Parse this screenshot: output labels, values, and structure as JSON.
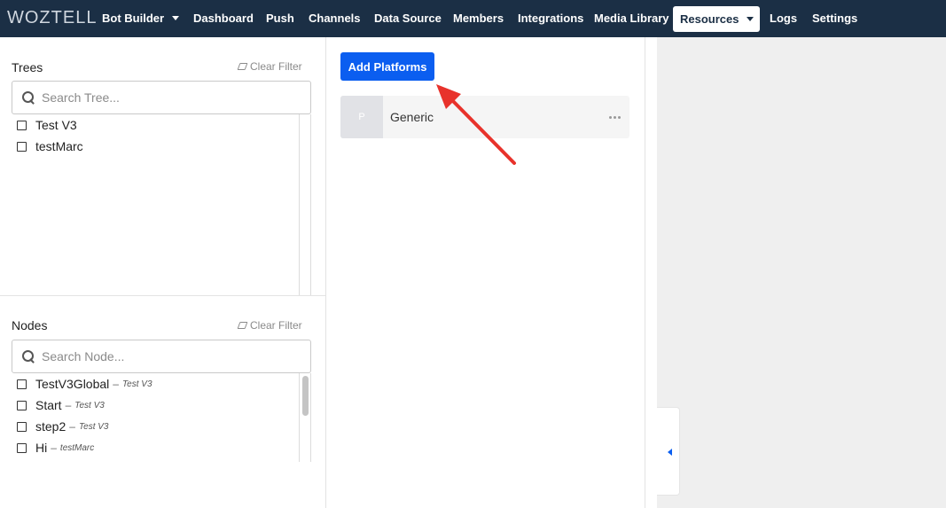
{
  "brand": {
    "logo": "WOZTELL",
    "accent": "#3bb3c9",
    "nav_bg": "#1b2f45"
  },
  "nav": {
    "items": [
      {
        "label": "Bot Builder"
      },
      {
        "label": "Dashboard"
      },
      {
        "label": "Push"
      },
      {
        "label": "Channels"
      },
      {
        "label": "Data Source"
      },
      {
        "label": "Members"
      },
      {
        "label": "Integrations"
      },
      {
        "label": "Media Library"
      },
      {
        "label": "Resources"
      },
      {
        "label": "Logs"
      },
      {
        "label": "Settings"
      }
    ],
    "active": "Resources"
  },
  "trees": {
    "title": "Trees",
    "clear_filter": "Clear Filter",
    "search_placeholder": "Search Tree...",
    "items": [
      {
        "label": "Test V3"
      },
      {
        "label": "testMarc"
      }
    ]
  },
  "nodes": {
    "title": "Nodes",
    "clear_filter": "Clear Filter",
    "search_placeholder": "Search Node...",
    "separator": "–",
    "items": [
      {
        "label": "TestV3Global",
        "tree": "Test V3"
      },
      {
        "label": "Start",
        "tree": "Test V3"
      },
      {
        "label": "step2",
        "tree": "Test V3"
      },
      {
        "label": "Hi",
        "tree": "testMarc"
      }
    ]
  },
  "platforms": {
    "add_button": "Add Platforms",
    "button_color": "#0b5ef0",
    "cards": [
      {
        "thumb": "P",
        "name": "Generic"
      }
    ]
  },
  "annotation": {
    "color": "#e8322b"
  }
}
